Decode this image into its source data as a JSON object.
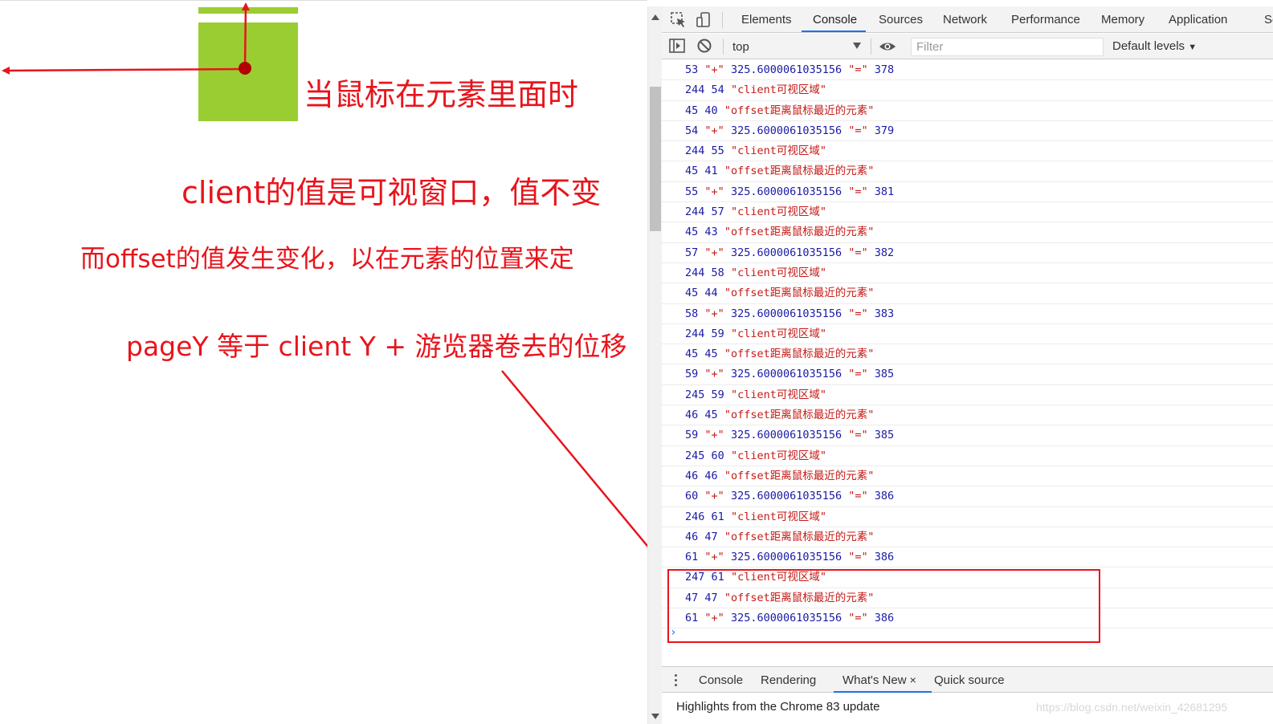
{
  "page": {
    "annotations": [
      "当鼠标在元素里面时",
      "client的值是可视窗口，值不变",
      "而offset的值发生变化，以在元素的位置来定",
      "pageY 等于 client Y + 游览器卷去的位移"
    ],
    "colors": {
      "box": "#9acd32",
      "annotation": "#e8141c"
    }
  },
  "devtools": {
    "tabs": [
      "Elements",
      "Console",
      "Sources",
      "Network",
      "Performance",
      "Memory",
      "Application",
      "Se"
    ],
    "active_tab": "Console",
    "toolbar": {
      "context": "top",
      "filter_placeholder": "Filter",
      "levels": "Default levels"
    },
    "console_lines": [
      [
        {
          "t": "num",
          "v": "53"
        },
        {
          "t": "str",
          "v": "\"+\""
        },
        {
          "t": "num",
          "v": "325.6000061035156"
        },
        {
          "t": "str",
          "v": "\"=\""
        },
        {
          "t": "num",
          "v": "378"
        }
      ],
      [
        {
          "t": "num",
          "v": "244"
        },
        {
          "t": "num",
          "v": "54"
        },
        {
          "t": "str",
          "v": "\"client可视区域\""
        }
      ],
      [
        {
          "t": "num",
          "v": "45"
        },
        {
          "t": "num",
          "v": "40"
        },
        {
          "t": "str",
          "v": "\"offset距离鼠标最近的元素\""
        }
      ],
      [
        {
          "t": "num",
          "v": "54"
        },
        {
          "t": "str",
          "v": "\"+\""
        },
        {
          "t": "num",
          "v": "325.6000061035156"
        },
        {
          "t": "str",
          "v": "\"=\""
        },
        {
          "t": "num",
          "v": "379"
        }
      ],
      [
        {
          "t": "num",
          "v": "244"
        },
        {
          "t": "num",
          "v": "55"
        },
        {
          "t": "str",
          "v": "\"client可视区域\""
        }
      ],
      [
        {
          "t": "num",
          "v": "45"
        },
        {
          "t": "num",
          "v": "41"
        },
        {
          "t": "str",
          "v": "\"offset距离鼠标最近的元素\""
        }
      ],
      [
        {
          "t": "num",
          "v": "55"
        },
        {
          "t": "str",
          "v": "\"+\""
        },
        {
          "t": "num",
          "v": "325.6000061035156"
        },
        {
          "t": "str",
          "v": "\"=\""
        },
        {
          "t": "num",
          "v": "381"
        }
      ],
      [
        {
          "t": "num",
          "v": "244"
        },
        {
          "t": "num",
          "v": "57"
        },
        {
          "t": "str",
          "v": "\"client可视区域\""
        }
      ],
      [
        {
          "t": "num",
          "v": "45"
        },
        {
          "t": "num",
          "v": "43"
        },
        {
          "t": "str",
          "v": "\"offset距离鼠标最近的元素\""
        }
      ],
      [
        {
          "t": "num",
          "v": "57"
        },
        {
          "t": "str",
          "v": "\"+\""
        },
        {
          "t": "num",
          "v": "325.6000061035156"
        },
        {
          "t": "str",
          "v": "\"=\""
        },
        {
          "t": "num",
          "v": "382"
        }
      ],
      [
        {
          "t": "num",
          "v": "244"
        },
        {
          "t": "num",
          "v": "58"
        },
        {
          "t": "str",
          "v": "\"client可视区域\""
        }
      ],
      [
        {
          "t": "num",
          "v": "45"
        },
        {
          "t": "num",
          "v": "44"
        },
        {
          "t": "str",
          "v": "\"offset距离鼠标最近的元素\""
        }
      ],
      [
        {
          "t": "num",
          "v": "58"
        },
        {
          "t": "str",
          "v": "\"+\""
        },
        {
          "t": "num",
          "v": "325.6000061035156"
        },
        {
          "t": "str",
          "v": "\"=\""
        },
        {
          "t": "num",
          "v": "383"
        }
      ],
      [
        {
          "t": "num",
          "v": "244"
        },
        {
          "t": "num",
          "v": "59"
        },
        {
          "t": "str",
          "v": "\"client可视区域\""
        }
      ],
      [
        {
          "t": "num",
          "v": "45"
        },
        {
          "t": "num",
          "v": "45"
        },
        {
          "t": "str",
          "v": "\"offset距离鼠标最近的元素\""
        }
      ],
      [
        {
          "t": "num",
          "v": "59"
        },
        {
          "t": "str",
          "v": "\"+\""
        },
        {
          "t": "num",
          "v": "325.6000061035156"
        },
        {
          "t": "str",
          "v": "\"=\""
        },
        {
          "t": "num",
          "v": "385"
        }
      ],
      [
        {
          "t": "num",
          "v": "245"
        },
        {
          "t": "num",
          "v": "59"
        },
        {
          "t": "str",
          "v": "\"client可视区域\""
        }
      ],
      [
        {
          "t": "num",
          "v": "46"
        },
        {
          "t": "num",
          "v": "45"
        },
        {
          "t": "str",
          "v": "\"offset距离鼠标最近的元素\""
        }
      ],
      [
        {
          "t": "num",
          "v": "59"
        },
        {
          "t": "str",
          "v": "\"+\""
        },
        {
          "t": "num",
          "v": "325.6000061035156"
        },
        {
          "t": "str",
          "v": "\"=\""
        },
        {
          "t": "num",
          "v": "385"
        }
      ],
      [
        {
          "t": "num",
          "v": "245"
        },
        {
          "t": "num",
          "v": "60"
        },
        {
          "t": "str",
          "v": "\"client可视区域\""
        }
      ],
      [
        {
          "t": "num",
          "v": "46"
        },
        {
          "t": "num",
          "v": "46"
        },
        {
          "t": "str",
          "v": "\"offset距离鼠标最近的元素\""
        }
      ],
      [
        {
          "t": "num",
          "v": "60"
        },
        {
          "t": "str",
          "v": "\"+\""
        },
        {
          "t": "num",
          "v": "325.6000061035156"
        },
        {
          "t": "str",
          "v": "\"=\""
        },
        {
          "t": "num",
          "v": "386"
        }
      ],
      [
        {
          "t": "num",
          "v": "246"
        },
        {
          "t": "num",
          "v": "61"
        },
        {
          "t": "str",
          "v": "\"client可视区域\""
        }
      ],
      [
        {
          "t": "num",
          "v": "46"
        },
        {
          "t": "num",
          "v": "47"
        },
        {
          "t": "str",
          "v": "\"offset距离鼠标最近的元素\""
        }
      ],
      [
        {
          "t": "num",
          "v": "61"
        },
        {
          "t": "str",
          "v": "\"+\""
        },
        {
          "t": "num",
          "v": "325.6000061035156"
        },
        {
          "t": "str",
          "v": "\"=\""
        },
        {
          "t": "num",
          "v": "386"
        }
      ],
      [
        {
          "t": "num",
          "v": "247"
        },
        {
          "t": "num",
          "v": "61"
        },
        {
          "t": "str",
          "v": "\"client可视区域\""
        }
      ],
      [
        {
          "t": "num",
          "v": "47"
        },
        {
          "t": "num",
          "v": "47"
        },
        {
          "t": "str",
          "v": "\"offset距离鼠标最近的元素\""
        }
      ],
      [
        {
          "t": "num",
          "v": "61"
        },
        {
          "t": "str",
          "v": "\"+\""
        },
        {
          "t": "num",
          "v": "325.6000061035156"
        },
        {
          "t": "str",
          "v": "\"=\""
        },
        {
          "t": "num",
          "v": "386"
        }
      ]
    ],
    "prompt": "›",
    "drawer": {
      "tabs": [
        "Console",
        "Rendering",
        "What's New",
        "Quick source"
      ],
      "active_tab": "What's New",
      "close": "×",
      "body": "Highlights from the Chrome 83 update",
      "watermark": "https://blog.csdn.net/weixin_42681295"
    },
    "colors": {
      "accent": "#1a73e8",
      "number": "#1a1aa6",
      "string": "#c41a16"
    }
  }
}
